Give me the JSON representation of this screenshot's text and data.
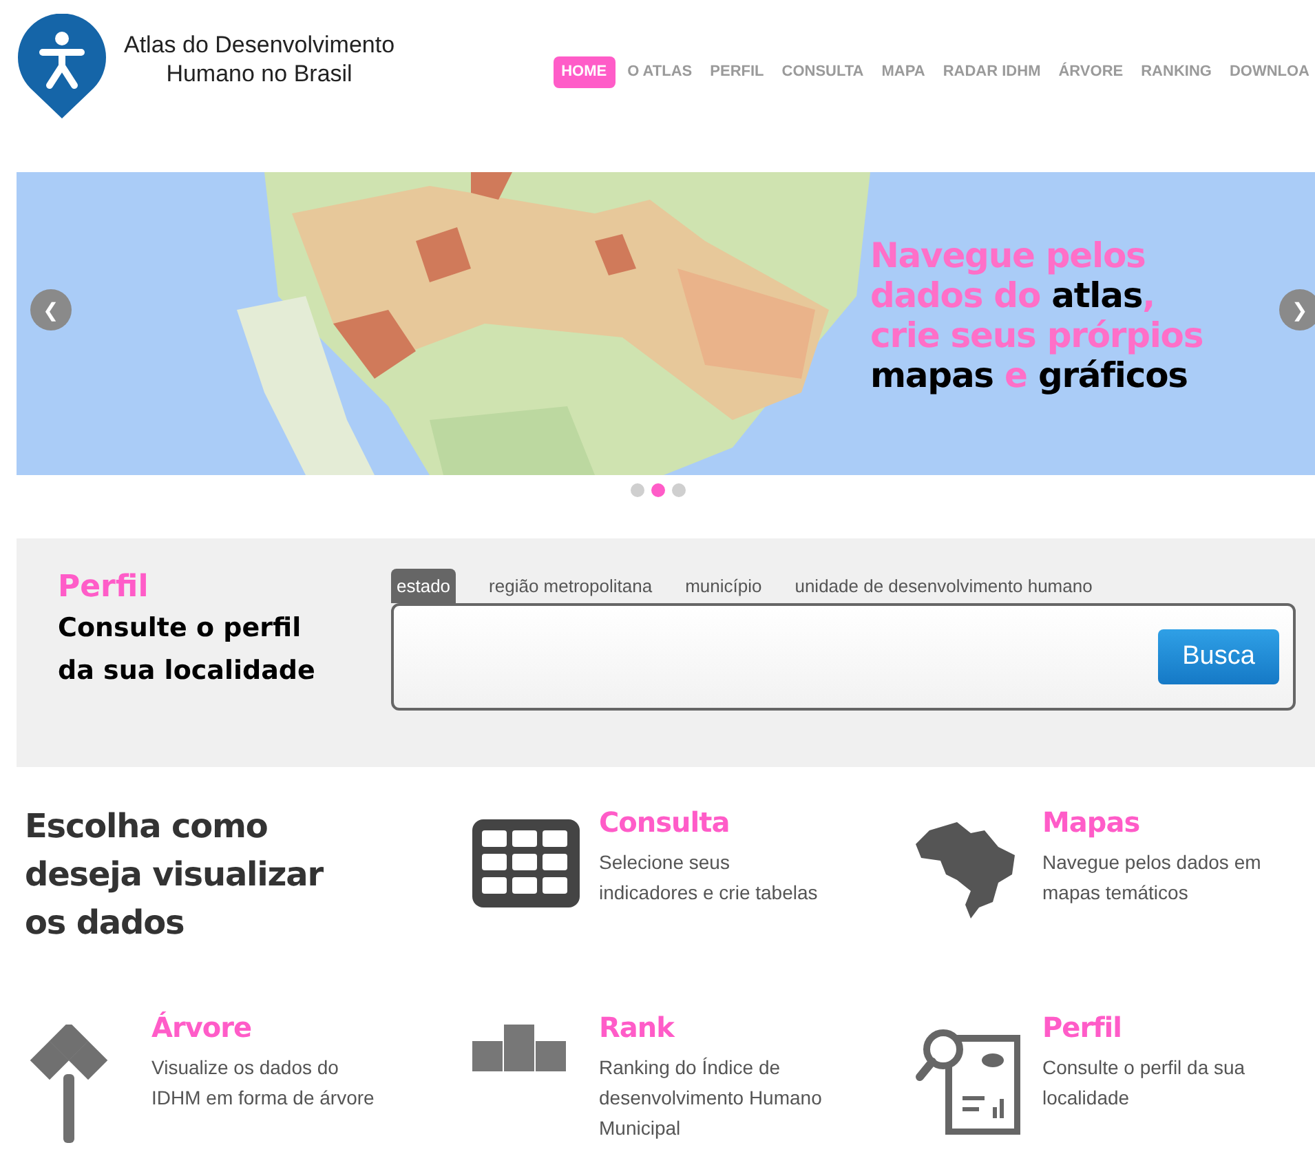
{
  "logo": {
    "line1": "Atlas do Desenvolvimento",
    "line2": "Humano no Brasil"
  },
  "nav": [
    {
      "label": "HOME",
      "selected": true
    },
    {
      "label": "O ATLAS",
      "selected": false
    },
    {
      "label": "PERFIL",
      "selected": false
    },
    {
      "label": "CONSULTA",
      "selected": false
    },
    {
      "label": "MAPA",
      "selected": false
    },
    {
      "label": "RADAR IDHM",
      "selected": false
    },
    {
      "label": "ÁRVORE",
      "selected": false
    },
    {
      "label": "RANKING",
      "selected": false
    },
    {
      "label": "DOWNLOA",
      "selected": false
    }
  ],
  "carousel": {
    "prev": "❮",
    "next": "❯",
    "slide": {
      "kind": "picture",
      "lines": [
        [
          {
            "text": "Navegue pelos",
            "kind": "accent"
          }
        ],
        [
          {
            "text": "dados do ",
            "kind": "accent"
          },
          {
            "text": "atlas",
            "kind": "plain"
          },
          {
            "text": ",",
            "kind": "accent"
          }
        ],
        [
          {
            "text": "crie seus prórpios",
            "kind": "accent"
          }
        ],
        [
          {
            "text": "mapas ",
            "kind": "plain"
          },
          {
            "text": "e ",
            "kind": "accent"
          },
          {
            "text": "gráficos",
            "kind": "plain"
          }
        ]
      ]
    },
    "dots": [
      {
        "selected": false
      },
      {
        "selected": true
      },
      {
        "selected": false
      }
    ]
  },
  "perfil": {
    "title": "Perfil",
    "subtitle": "Consulte o perfil da sua localidade",
    "tabs": [
      {
        "label": "estado",
        "selected": true
      },
      {
        "label": "região metropolitana",
        "selected": false
      },
      {
        "label": "município",
        "selected": false
      },
      {
        "label": "unidade de desenvolvimento humano",
        "selected": false
      }
    ],
    "button": "Busca"
  },
  "features": {
    "heading": "Escolha como deseja visualizar os dados",
    "items": [
      {
        "kind": "table",
        "title": "Consulta",
        "text": "Selecione seus indicadores e crie tabelas"
      },
      {
        "kind": "map",
        "title": "Mapas",
        "text": "Navegue pelos dados em mapas temáticos"
      },
      {
        "kind": "tree",
        "title": "Árvore",
        "text": "Visualize os dados do IDHM em forma de árvore"
      },
      {
        "kind": "rank",
        "title": "Rank",
        "text": "Ranking do Índice de desenvolvimento Humano Municipal"
      },
      {
        "kind": "profile",
        "title": "Perfil",
        "text": "Consulte o perfil da sua localidade"
      }
    ]
  }
}
